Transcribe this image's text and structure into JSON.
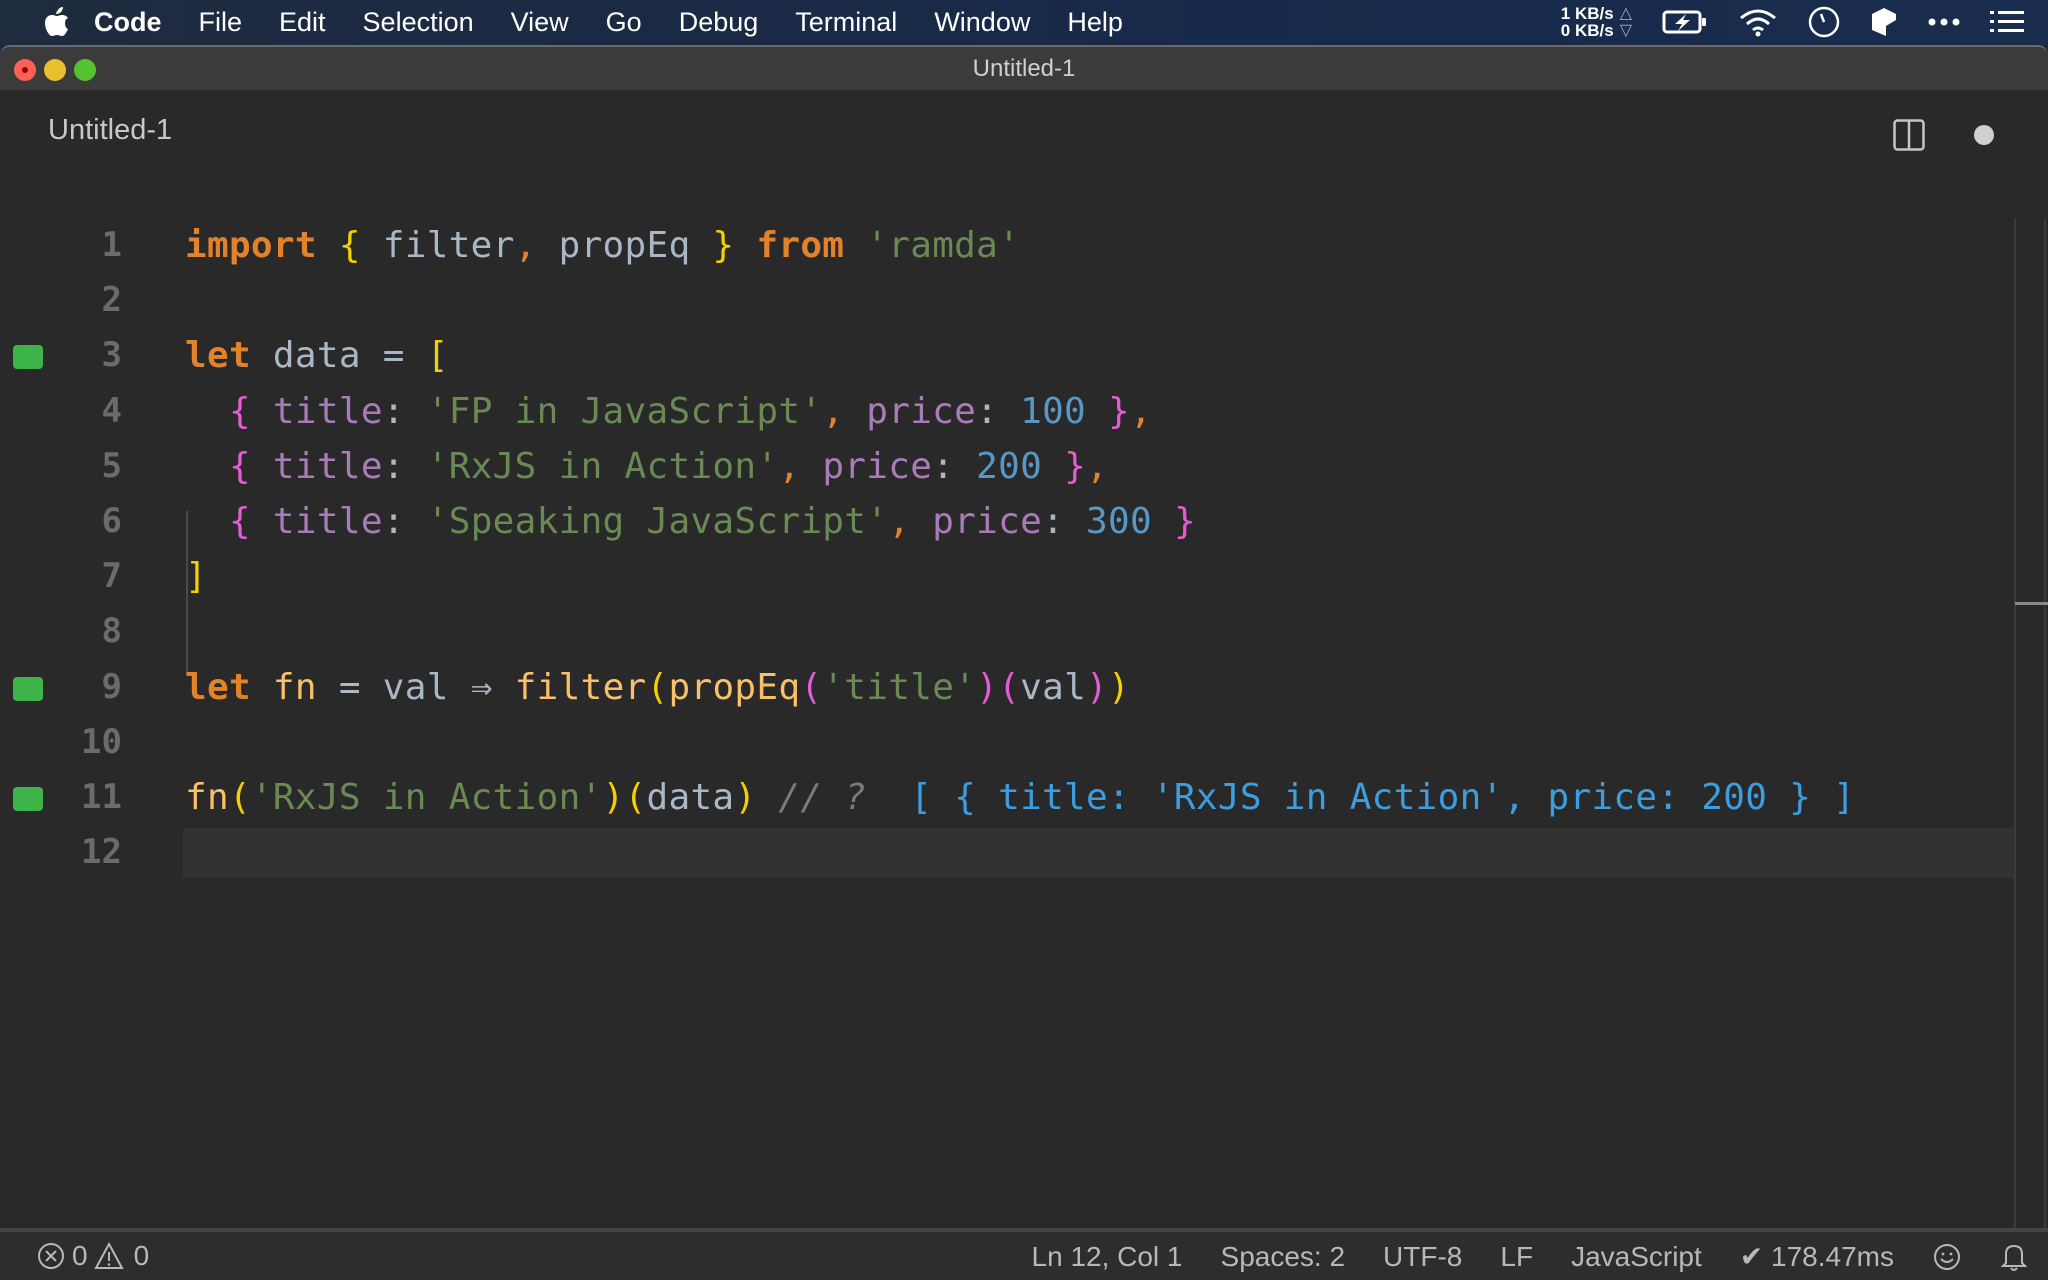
{
  "menubar": {
    "app_name": "Code",
    "items": [
      "File",
      "Edit",
      "Selection",
      "View",
      "Go",
      "Debug",
      "Terminal",
      "Window",
      "Help"
    ],
    "net_up": "1 KB/s",
    "net_down": "0 KB/s",
    "tray_icons": [
      "battery-charging-icon",
      "wifi-icon",
      "clock-icon",
      "dropbox-icon",
      "more-icon",
      "notification-list-icon"
    ]
  },
  "window": {
    "title": "Untitled-1",
    "tab_label": "Untitled-1"
  },
  "editor": {
    "current_line": 12,
    "lines": [
      {
        "n": "1",
        "marker": false,
        "tokens": [
          [
            "kw",
            "import"
          ],
          [
            "id",
            " "
          ],
          [
            "br1",
            "{"
          ],
          [
            "id",
            " filter"
          ],
          [
            "punc",
            ","
          ],
          [
            "id",
            " propEq "
          ],
          [
            "br1",
            "}"
          ],
          [
            "id",
            " "
          ],
          [
            "kw",
            "from"
          ],
          [
            "id",
            " "
          ],
          [
            "str",
            "'ramda'"
          ]
        ]
      },
      {
        "n": "2",
        "marker": false,
        "tokens": []
      },
      {
        "n": "3",
        "marker": true,
        "tokens": [
          [
            "kw",
            "let"
          ],
          [
            "id",
            " data "
          ],
          [
            "colon",
            "="
          ],
          [
            "id",
            " "
          ],
          [
            "br1",
            "["
          ]
        ]
      },
      {
        "n": "4",
        "marker": false,
        "tokens": [
          [
            "id",
            "  "
          ],
          [
            "br2",
            "{"
          ],
          [
            "id",
            " "
          ],
          [
            "prop",
            "title"
          ],
          [
            "colon",
            ":"
          ],
          [
            "id",
            " "
          ],
          [
            "str",
            "'FP in JavaScript'"
          ],
          [
            "punc",
            ","
          ],
          [
            "id",
            " "
          ],
          [
            "prop",
            "price"
          ],
          [
            "colon",
            ":"
          ],
          [
            "id",
            " "
          ],
          [
            "num",
            "100"
          ],
          [
            "id",
            " "
          ],
          [
            "br2",
            "}"
          ],
          [
            "punc",
            ","
          ]
        ]
      },
      {
        "n": "5",
        "marker": false,
        "tokens": [
          [
            "id",
            "  "
          ],
          [
            "br2",
            "{"
          ],
          [
            "id",
            " "
          ],
          [
            "prop",
            "title"
          ],
          [
            "colon",
            ":"
          ],
          [
            "id",
            " "
          ],
          [
            "str",
            "'RxJS in Action'"
          ],
          [
            "punc",
            ","
          ],
          [
            "id",
            " "
          ],
          [
            "prop",
            "price"
          ],
          [
            "colon",
            ":"
          ],
          [
            "id",
            " "
          ],
          [
            "num",
            "200"
          ],
          [
            "id",
            " "
          ],
          [
            "br2",
            "}"
          ],
          [
            "punc",
            ","
          ]
        ]
      },
      {
        "n": "6",
        "marker": false,
        "tokens": [
          [
            "id",
            "  "
          ],
          [
            "br2",
            "{"
          ],
          [
            "id",
            " "
          ],
          [
            "prop",
            "title"
          ],
          [
            "colon",
            ":"
          ],
          [
            "id",
            " "
          ],
          [
            "str",
            "'Speaking JavaScript'"
          ],
          [
            "punc",
            ","
          ],
          [
            "id",
            " "
          ],
          [
            "prop",
            "price"
          ],
          [
            "colon",
            ":"
          ],
          [
            "id",
            " "
          ],
          [
            "num",
            "300"
          ],
          [
            "id",
            " "
          ],
          [
            "br2",
            "}"
          ]
        ]
      },
      {
        "n": "7",
        "marker": false,
        "tokens": [
          [
            "br1",
            "]"
          ]
        ]
      },
      {
        "n": "8",
        "marker": false,
        "tokens": []
      },
      {
        "n": "9",
        "marker": true,
        "tokens": [
          [
            "kw",
            "let"
          ],
          [
            "id",
            " "
          ],
          [
            "fn",
            "fn"
          ],
          [
            "id",
            " "
          ],
          [
            "colon",
            "="
          ],
          [
            "id",
            " val "
          ],
          [
            "id",
            "⇒"
          ],
          [
            "id",
            " "
          ],
          [
            "fn",
            "filter"
          ],
          [
            "br1",
            "("
          ],
          [
            "fn",
            "propEq"
          ],
          [
            "br2",
            "("
          ],
          [
            "str",
            "'title'"
          ],
          [
            "br2",
            ")"
          ],
          [
            "br2",
            "("
          ],
          [
            "id",
            "val"
          ],
          [
            "br2",
            ")"
          ],
          [
            "br1",
            ")"
          ]
        ]
      },
      {
        "n": "10",
        "marker": false,
        "tokens": []
      },
      {
        "n": "11",
        "marker": true,
        "tokens": [
          [
            "fn",
            "fn"
          ],
          [
            "br1",
            "("
          ],
          [
            "str",
            "'RxJS in Action'"
          ],
          [
            "br1",
            ")"
          ],
          [
            "br1",
            "("
          ],
          [
            "id",
            "data"
          ],
          [
            "br1",
            ")"
          ],
          [
            "id",
            " "
          ],
          [
            "cmt",
            "// ?"
          ],
          [
            "id",
            "  "
          ],
          [
            "result",
            "[ { title: 'RxJS in Action', price: 200 } ]"
          ]
        ]
      },
      {
        "n": "12",
        "marker": false,
        "tokens": []
      }
    ]
  },
  "statusbar": {
    "errors": "0",
    "warnings": "0",
    "cursor_position": "Ln 12, Col 1",
    "indentation": "Spaces: 2",
    "encoding": "UTF-8",
    "eol": "LF",
    "language": "JavaScript",
    "quokka_timing": "✔ 178.47ms"
  }
}
